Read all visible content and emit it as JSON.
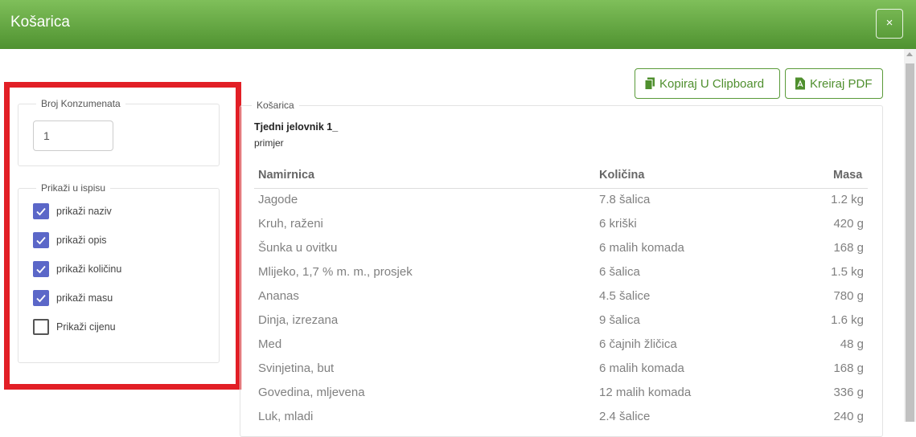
{
  "modal": {
    "title": "Košarica",
    "close_label": "×"
  },
  "settings": {
    "consumers_legend": "Broj Konzumenata",
    "consumers_value": "1",
    "print_legend": "Prikaži u ispisu",
    "options": [
      {
        "label": "prikaži naziv",
        "checked": true
      },
      {
        "label": "prikaži opis",
        "checked": true
      },
      {
        "label": "prikaži količinu",
        "checked": true
      },
      {
        "label": "prikaži masu",
        "checked": true
      },
      {
        "label": "Prikaži cijenu",
        "checked": false
      }
    ]
  },
  "toolbar": {
    "copy_label": "Kopiraj U Clipboard",
    "pdf_label": "Kreiraj PDF"
  },
  "cart": {
    "legend": "Košarica",
    "title": "Tjedni jelovnik 1_",
    "subtitle": "primjer",
    "columns": [
      "Namirnica",
      "Količina",
      "Masa"
    ],
    "rows": [
      [
        "Jagode",
        "7.8 šalica",
        "1.2 kg"
      ],
      [
        "Kruh, raženi",
        "6 kriški",
        "420 g"
      ],
      [
        "Šunka u ovitku",
        "6 malih komada",
        "168 g"
      ],
      [
        "Mlijeko, 1,7 % m. m., prosjek",
        "6 šalica",
        "1.5 kg"
      ],
      [
        "Ananas",
        "4.5 šalice",
        "780 g"
      ],
      [
        "Dinja, izrezana",
        "9 šalica",
        "1.6 kg"
      ],
      [
        "Med",
        "6 čajnih žličica",
        "48 g"
      ],
      [
        "Svinjetina, but",
        "6 malih komada",
        "168 g"
      ],
      [
        "Govedina, mljevena",
        "12 malih komada",
        "336 g"
      ],
      [
        "Luk, mladi",
        "2.4 šalice",
        "240 g"
      ]
    ]
  },
  "colors": {
    "header_green": "#5a9a39",
    "checkbox_blue": "#5b67c8",
    "highlight_red": "#e21f26"
  }
}
